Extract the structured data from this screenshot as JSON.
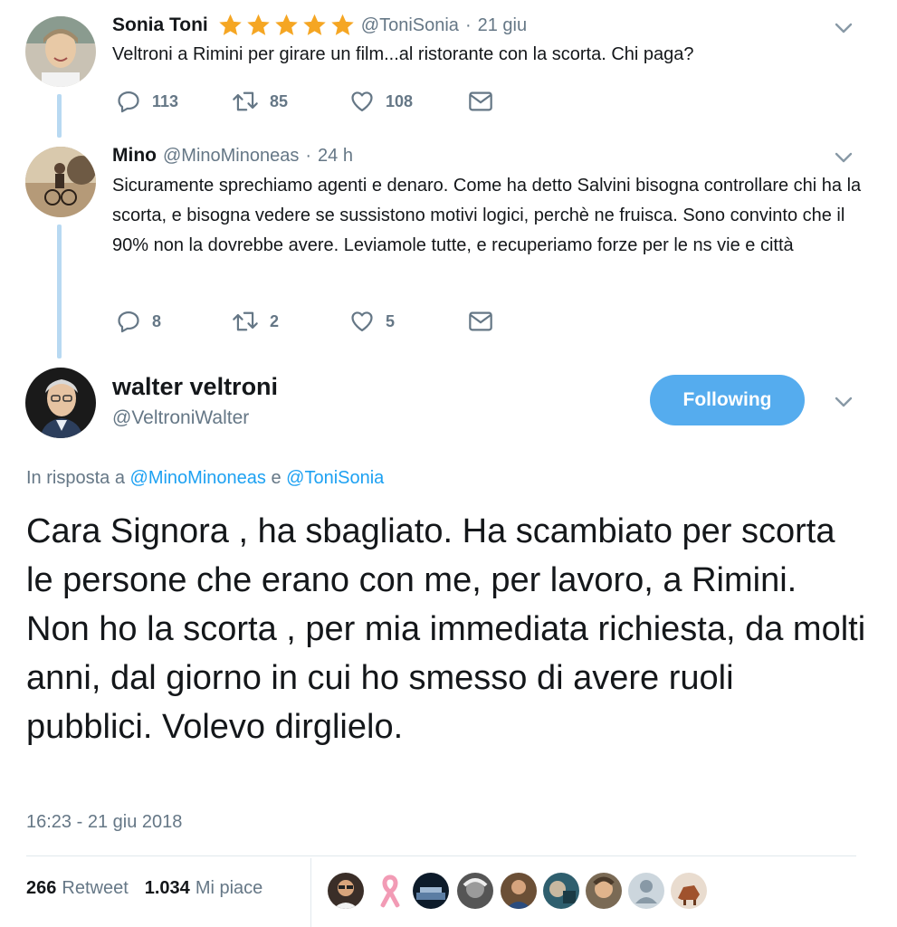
{
  "tweets": [
    {
      "name": "Sonia Toni",
      "handle": "@ToniSonia",
      "sep": "·",
      "time": "21 giu",
      "text": "Veltroni a Rimini per girare un film...al ristorante con la scorta. Chi paga?",
      "replies": "113",
      "retweets": "85",
      "likes": "108"
    },
    {
      "name": "Mino",
      "handle": "@MinoMinoneas",
      "sep": "·",
      "time": "24 h",
      "text": "Sicuramente sprechiamo agenti e denaro. Come ha detto Salvini bisogna controllare chi ha la scorta, e bisogna vedere se sussistono motivi logici, perchè ne fruisca. Sono convinto che il 90% non la dovrebbe avere. Leviamole tutte, e recuperiamo forze per le ns vie e città",
      "replies": "8",
      "retweets": "2",
      "likes": "5"
    }
  ],
  "main": {
    "name": "walter veltroni",
    "handle": "@VeltroniWalter",
    "follow_label": "Following",
    "reply_prefix": "In risposta a",
    "reply_to_1": "@MinoMinoneas",
    "reply_conj": "e",
    "reply_to_2": "@ToniSonia",
    "text": "Cara Signora , ha sbagliato. Ha scambiato per scorta le persone che erano con me, per lavoro, a Rimini. Non ho la scorta , per mia immediata richiesta, da molti anni, dal giorno in cui ho smesso di avere ruoli pubblici. Volevo dirglielo.",
    "timestamp": "16:23 - 21 giu 2018",
    "retweet_count": "266",
    "retweet_label": "Retweet",
    "like_count": "1.034",
    "like_label": "Mi piace"
  },
  "colors": {
    "accent": "#55acee",
    "star": "#f5a623",
    "muted": "#657786",
    "link": "#1da1f2"
  },
  "icons": {
    "reply": "reply-icon",
    "retweet": "retweet-icon",
    "like": "heart-icon",
    "dm": "envelope-icon",
    "more": "chevron-down-icon",
    "rating": "star-icon"
  }
}
